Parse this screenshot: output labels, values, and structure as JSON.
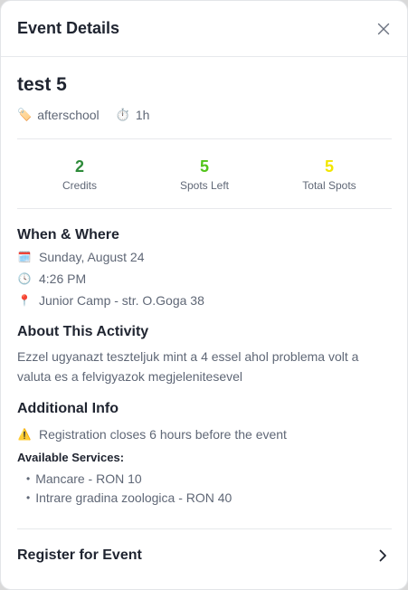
{
  "header": {
    "title": "Event Details",
    "close_icon": "close-icon"
  },
  "event": {
    "title": "test 5",
    "tags": [
      {
        "icon": "tag-icon",
        "emoji": "🏷️",
        "label": "afterschool"
      },
      {
        "icon": "stopwatch-icon",
        "emoji": "⏱️",
        "label": "1h"
      }
    ]
  },
  "stats": [
    {
      "value": "2",
      "label": "Credits",
      "color": "#2e8b3a"
    },
    {
      "value": "5",
      "label": "Spots Left",
      "color": "#52c41a"
    },
    {
      "value": "5",
      "label": "Total Spots",
      "color": "#f2e600"
    }
  ],
  "when_where": {
    "title": "When & Where",
    "date": {
      "icon": "calendar-icon",
      "emoji": "🗓️",
      "text": "Sunday, August 24"
    },
    "time": {
      "icon": "clock-icon",
      "emoji": "🕓",
      "text": "4:26 PM"
    },
    "location": {
      "icon": "pin-icon",
      "emoji": "📍",
      "text": "Junior Camp - str. O.Goga 38"
    }
  },
  "about": {
    "title": "About This Activity",
    "description": "Ezzel ugyanazt teszteljuk mint a 4 essel ahol problema volt a valuta es a felvigyazok megjelenitesevel"
  },
  "additional": {
    "title": "Additional Info",
    "warning": {
      "icon": "warning-icon",
      "emoji": "⚠️",
      "text": "Registration closes 6 hours before the event"
    },
    "services_label": "Available Services:",
    "services": [
      "Mancare - RON 10",
      "Intrare gradina zoologica - RON 40"
    ]
  },
  "register": {
    "label": "Register for Event",
    "icon": "chevron-right-icon"
  }
}
